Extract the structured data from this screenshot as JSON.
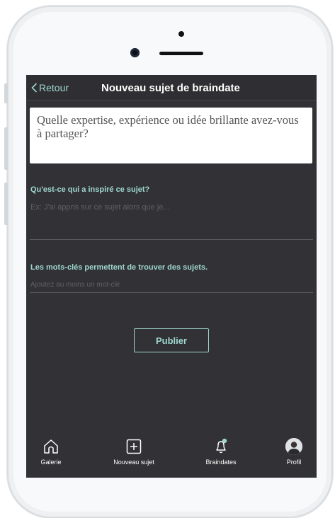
{
  "nav": {
    "back_label": "Retour",
    "title": "Nouveau sujet de braindate"
  },
  "topic": {
    "placeholder": "Quelle expertise, expérience ou idée brillante avez-vous à partager?"
  },
  "inspiration": {
    "label": "Qu'est-ce qui a inspiré ce sujet?",
    "placeholder": "Ex: J'ai appris sur ce sujet alors que je..."
  },
  "keywords": {
    "label": "Les mots-clés permettent de trouver des sujets.",
    "placeholder": "Ajoutez au moins un mot-clé"
  },
  "publish_label": "Publier",
  "tabs": [
    {
      "label": "Galerie",
      "icon": "home-icon"
    },
    {
      "label": "Nouveau sujet",
      "icon": "plus-square-icon"
    },
    {
      "label": "Braindates",
      "icon": "bell-icon"
    },
    {
      "label": "Profil",
      "icon": "avatar"
    }
  ],
  "colors": {
    "accent": "#9fd6cf",
    "screen_bg": "#323236",
    "text": "#ffffff"
  }
}
